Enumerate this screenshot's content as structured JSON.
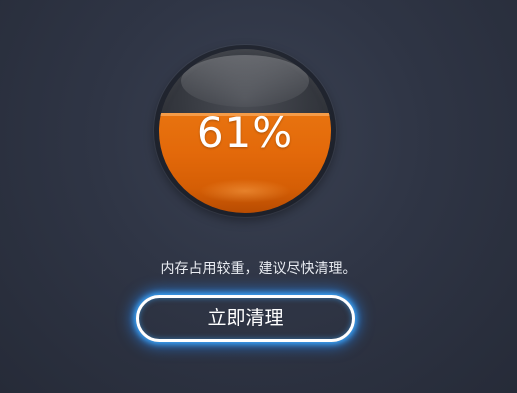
{
  "memory": {
    "usage_label": "61%",
    "usage_fraction": 0.61
  },
  "message": "内存占用较重，建议尽快清理。",
  "clean_button_label": "立即清理",
  "colors": {
    "background": "#2f3545",
    "fill": "#e3690a",
    "button_glow": "#3caaff"
  }
}
